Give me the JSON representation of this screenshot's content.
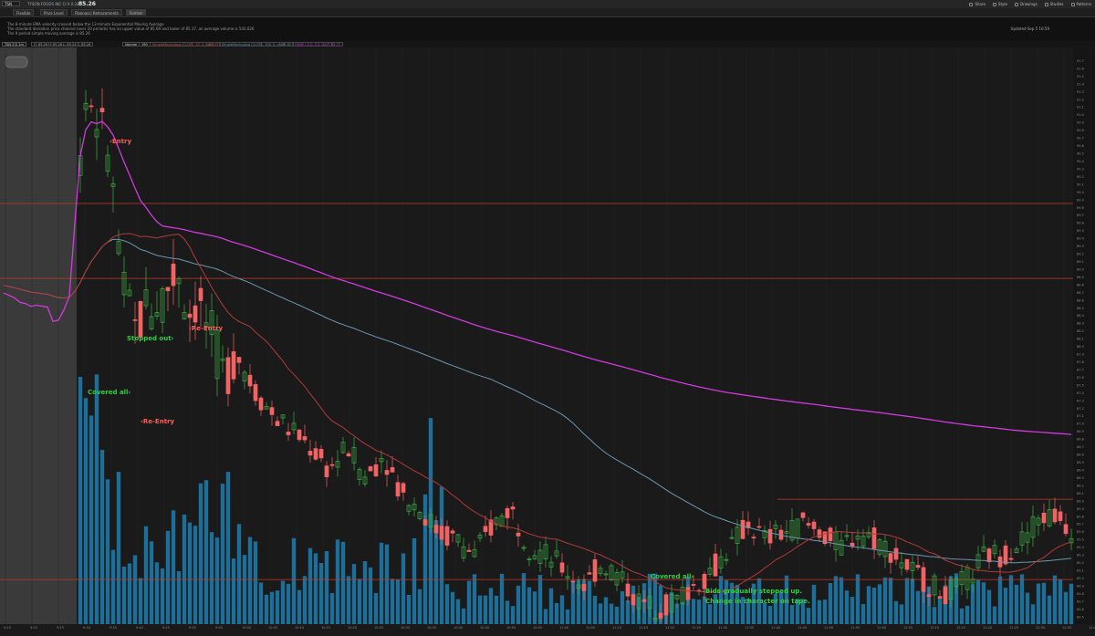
{
  "topbar": {
    "symbol": "TSN",
    "company": "TYSON FOODS INC CI A 0.24",
    "last_price": "85.26",
    "buttons": [
      "Share",
      "Style",
      "Drawings",
      "Studies",
      "Patterns"
    ]
  },
  "tabs": [
    "Flexible",
    "Price Level",
    "Fibonacci Retracements",
    "Former"
  ],
  "description": {
    "line1": "The 8-minute EMA velocity crossed below the 13-minute Exponential Moving Average",
    "line2": "The standard deviation price channel (over 20 periods) has an upper value of 85.69 and lower of 85.17, an average volume is 543,026",
    "line3": "The 9 period simple moving average is 85.26"
  },
  "updated_text": "Updated Sep 5 10:59",
  "studybar": {
    "symbol_label": "TSN 3 D 1m",
    "quote": "O: 85.26  H: 85.26  L: 85.24  C: 85.26",
    "volume_label": "Volume",
    "volume_value": "190",
    "sma1": "SimpleMovingAvg (CLOSE, 20, 0, no)",
    "sma1_value": "85.43",
    "sma2": "SimpleMovingAvg (CLOSE, 100, 0, no)",
    "sma2_value": "85.62",
    "vwap": "VWAP (-2.0, 2.0, DAY)",
    "vwap_value": "85.77"
  },
  "annotations": [
    {
      "text": "‹Entry",
      "color": "#ff5c5c"
    },
    {
      "text": "Stopped out›",
      "color": "#33cc44"
    },
    {
      "text": "‹Re-Entry",
      "color": "#ff5c5c"
    },
    {
      "text": "Covered all›",
      "color": "#33cc44"
    },
    {
      "text": "‹Re-Entry",
      "color": "#ff5c5c"
    },
    {
      "text": "Covered all›",
      "color": "#33cc44"
    },
    {
      "text": "‹Bids gradually stepped up.",
      "color": "#33cc44"
    },
    {
      "text": "Change in character on tape.",
      "color": "#33cc44"
    }
  ],
  "colors": {
    "up": "#3cb043",
    "down": "#f26464",
    "volume": "#1f6e98",
    "vwap": "#d03adf",
    "sma20": "#b23a3a",
    "sma100": "#6b96b0",
    "hline": "#c0392b",
    "premarket": "#3a3a3a"
  },
  "chart_data": {
    "type": "candlestick",
    "interval": "1m",
    "price_range": [
      84.45,
      91.8
    ],
    "time_labels": [
      "9:15",
      "9:20",
      "9:25",
      "9:30",
      "9:35",
      "9:40",
      "9:45",
      "9:50",
      "9:55",
      "10:00",
      "10:05",
      "10:10",
      "10:15",
      "10:20",
      "10:25",
      "10:30",
      "10:35",
      "10:40",
      "10:45",
      "10:50",
      "10:55",
      "11:00",
      "11:05",
      "11:10",
      "11:15",
      "11:20",
      "11:25",
      "11:30",
      "11:35",
      "11:40",
      "11:45",
      "11:50",
      "11:55",
      "12:00",
      "12:05",
      "12:10",
      "12:15",
      "12:20",
      "12:25",
      "12:30",
      "12:35",
      "12:40"
    ],
    "price_ticks": [
      91.7,
      91.6,
      91.5,
      91.4,
      91.3,
      91.2,
      91.1,
      91.0,
      90.9,
      90.8,
      90.7,
      90.6,
      90.5,
      90.4,
      90.3,
      90.2,
      90.1,
      90.0,
      89.9,
      89.8,
      89.7,
      89.6,
      89.5,
      89.4,
      89.3,
      89.2,
      89.1,
      89.0,
      88.9,
      88.8,
      88.7,
      88.6,
      88.5,
      88.4,
      88.3,
      88.2,
      88.1,
      88.0,
      87.9,
      87.8,
      87.7,
      87.6,
      87.5,
      87.4,
      87.3,
      87.2,
      87.1,
      87.0,
      86.9,
      86.8,
      86.7,
      86.6,
      86.5,
      86.4,
      86.3,
      86.2,
      86.1,
      86.0,
      85.9,
      85.8,
      85.7,
      85.6,
      85.5,
      85.4,
      85.3,
      85.2,
      85.1,
      85.0,
      84.9,
      84.8,
      84.7,
      84.6,
      84.5
    ],
    "horizontal_lines": [
      89.85,
      88.88,
      86.02,
      84.98
    ],
    "keypoints_close": [
      [
        0,
        88.8
      ],
      [
        50,
        88.6
      ],
      [
        60,
        88.4
      ],
      [
        75,
        88.6
      ],
      [
        85,
        90.2
      ],
      [
        95,
        91.3
      ],
      [
        105,
        91.0
      ],
      [
        118,
        90.6
      ],
      [
        128,
        89.5
      ],
      [
        136,
        88.7
      ],
      [
        148,
        88.2
      ],
      [
        160,
        88.5
      ],
      [
        175,
        88.6
      ],
      [
        190,
        88.9
      ],
      [
        198,
        89.0
      ],
      [
        205,
        88.4
      ],
      [
        215,
        88.6
      ],
      [
        230,
        88.2
      ],
      [
        245,
        87.6
      ],
      [
        260,
        87.9
      ],
      [
        280,
        87.4
      ],
      [
        300,
        87.1
      ],
      [
        320,
        86.9
      ],
      [
        340,
        86.7
      ],
      [
        360,
        86.4
      ],
      [
        380,
        86.7
      ],
      [
        400,
        86.3
      ],
      [
        420,
        86.6
      ],
      [
        440,
        86.1
      ],
      [
        460,
        85.9
      ],
      [
        480,
        85.6
      ],
      [
        500,
        85.5
      ],
      [
        520,
        85.3
      ],
      [
        540,
        85.7
      ],
      [
        560,
        85.9
      ],
      [
        580,
        85.4
      ],
      [
        600,
        85.3
      ],
      [
        620,
        85.1
      ],
      [
        640,
        84.9
      ],
      [
        660,
        85.2
      ],
      [
        680,
        85.0
      ],
      [
        700,
        84.7
      ],
      [
        720,
        84.6
      ],
      [
        740,
        84.7
      ],
      [
        760,
        84.9
      ],
      [
        780,
        85.1
      ],
      [
        800,
        85.4
      ],
      [
        820,
        85.7
      ],
      [
        840,
        85.5
      ],
      [
        860,
        85.6
      ],
      [
        880,
        85.7
      ],
      [
        900,
        85.6
      ],
      [
        920,
        85.4
      ],
      [
        940,
        85.6
      ],
      [
        960,
        85.5
      ],
      [
        980,
        85.3
      ],
      [
        1000,
        85.1
      ],
      [
        1020,
        84.9
      ],
      [
        1040,
        84.8
      ],
      [
        1060,
        85.0
      ],
      [
        1080,
        85.3
      ],
      [
        1100,
        85.3
      ],
      [
        1120,
        85.5
      ],
      [
        1140,
        85.8
      ],
      [
        1160,
        85.8
      ],
      [
        1175,
        85.6
      ]
    ]
  }
}
